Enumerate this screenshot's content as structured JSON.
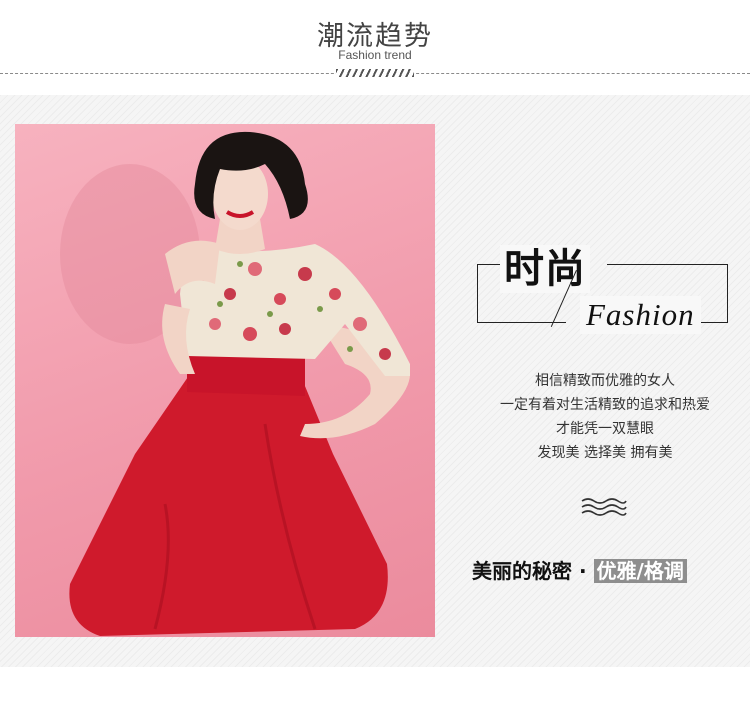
{
  "header": {
    "title": "潮流趋势",
    "subtitle": "Fashion trend"
  },
  "panel": {
    "big_title": "时尚",
    "fashion_word": "Fashion",
    "description": [
      "相信精致而优雅的女人",
      "一定有着对生活精致的追求和热爱",
      "才能凭一双慧眼",
      "发现美 选择美 拥有美"
    ],
    "slogan_prefix": "美丽的秘密 · ",
    "slogan_highlight": "优雅/格调"
  },
  "photo": {
    "subject": "woman in floral top and red full skirt",
    "colors": {
      "background": "#f19aab",
      "skirt": "#cf1a2c",
      "hair": "#1a1412",
      "skin": "#f2d4c6"
    }
  },
  "icons": {
    "decor": "wave-icon"
  }
}
